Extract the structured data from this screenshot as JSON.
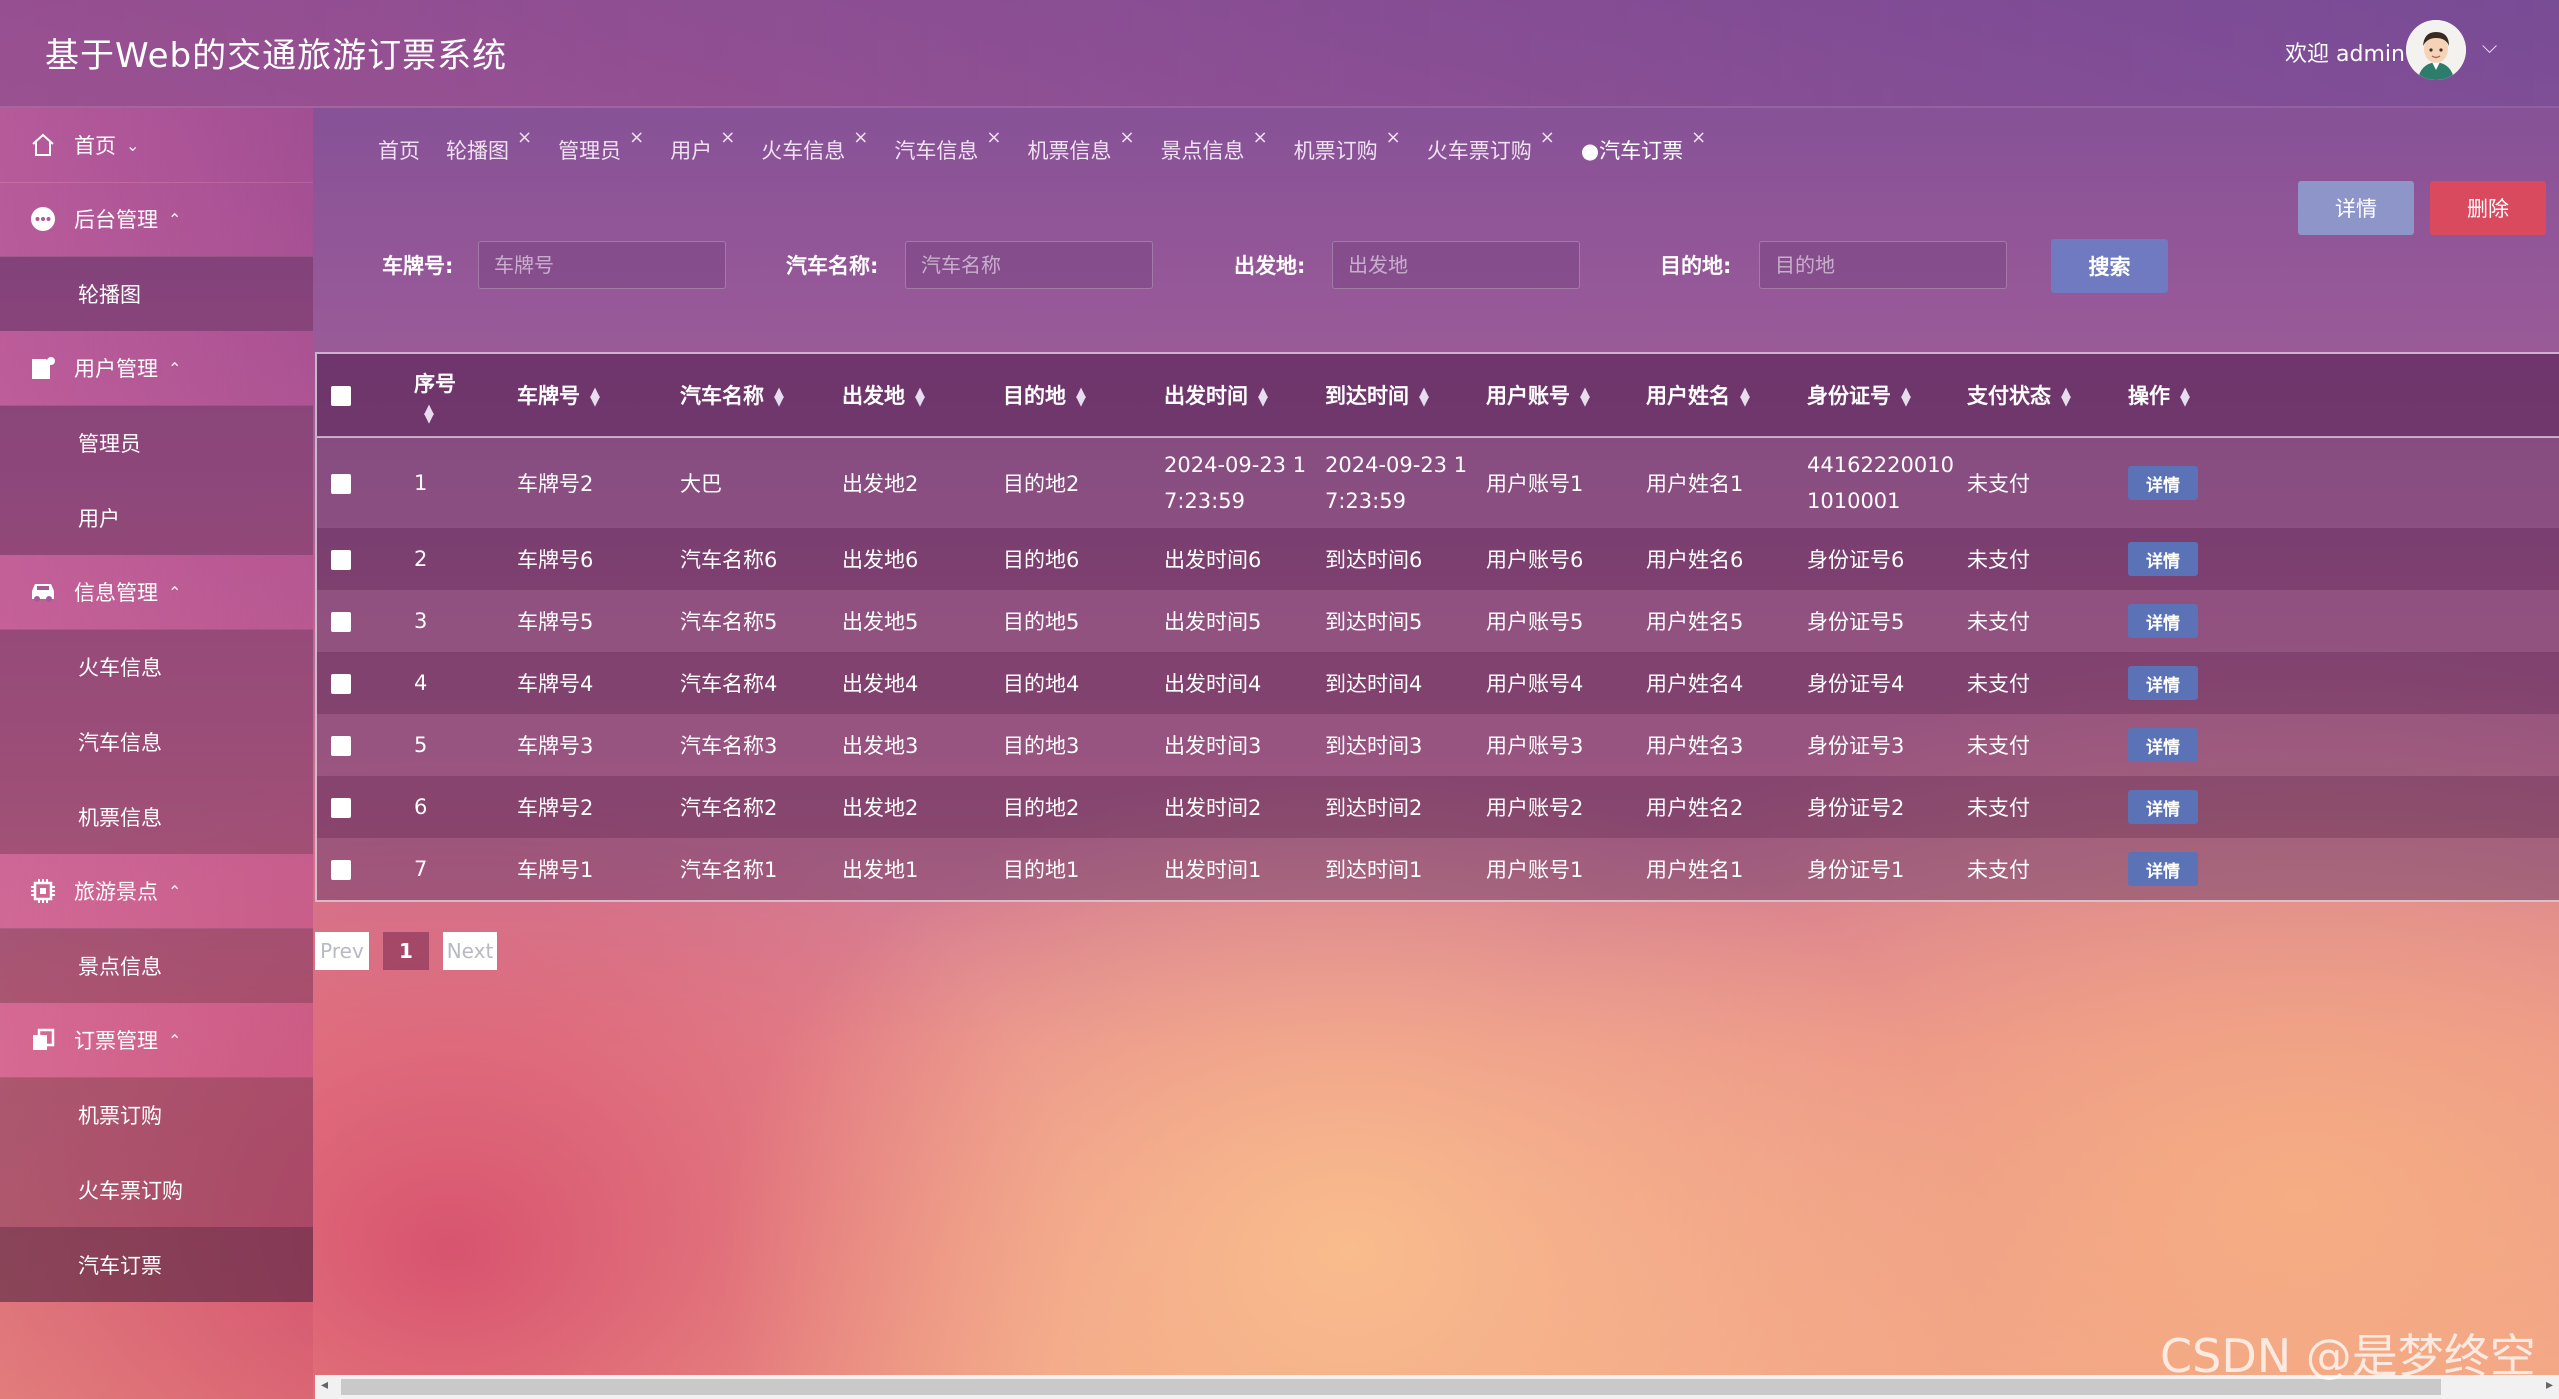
{
  "header": {
    "title": "基于Web的交通旅游订票系统",
    "welcome": "欢迎 admin",
    "avatar_icon": "user-avatar-icon",
    "dropdown_icon": "chevron-down-icon"
  },
  "sidebar": {
    "items": [
      {
        "label": "首页",
        "icon": "home-icon",
        "caret": "⌄"
      },
      {
        "label": "后台管理",
        "icon": "dots-icon",
        "caret": "⌃"
      },
      {
        "label": "轮播图"
      },
      {
        "label": "用户管理",
        "icon": "user-card-icon",
        "caret": "⌃"
      },
      {
        "label": "管理员"
      },
      {
        "label": "用户"
      },
      {
        "label": "信息管理",
        "icon": "car-icon",
        "caret": "⌃"
      },
      {
        "label": "火车信息"
      },
      {
        "label": "汽车信息"
      },
      {
        "label": "机票信息"
      },
      {
        "label": "旅游景点",
        "icon": "chip-icon",
        "caret": "⌃"
      },
      {
        "label": "景点信息"
      },
      {
        "label": "订票管理",
        "icon": "copy-icon",
        "caret": "⌃"
      },
      {
        "label": "机票订购"
      },
      {
        "label": "火车票订购"
      },
      {
        "label": "汽车订票"
      }
    ]
  },
  "tabs": [
    {
      "label": "首页",
      "closable": false
    },
    {
      "label": "轮播图",
      "closable": true
    },
    {
      "label": "管理员",
      "closable": true
    },
    {
      "label": "用户",
      "closable": true
    },
    {
      "label": "火车信息",
      "closable": true
    },
    {
      "label": "汽车信息",
      "closable": true
    },
    {
      "label": "机票信息",
      "closable": true
    },
    {
      "label": "景点信息",
      "closable": true
    },
    {
      "label": "机票订购",
      "closable": true
    },
    {
      "label": "火车票订购",
      "closable": true
    },
    {
      "label": "●汽车订票",
      "closable": true
    }
  ],
  "tab_close": "×",
  "actions": {
    "detail": "详情",
    "delete": "删除"
  },
  "search": {
    "plate_label": "车牌号:",
    "plate_placeholder": "车牌号",
    "name_label": "汽车名称:",
    "name_placeholder": "汽车名称",
    "from_label": "出发地:",
    "from_placeholder": "出发地",
    "to_label": "目的地:",
    "to_placeholder": "目的地",
    "button": "搜索"
  },
  "table": {
    "columns": [
      "序号",
      "车牌号",
      "汽车名称",
      "出发地",
      "目的地",
      "出发时间",
      "到达时间",
      "用户账号",
      "用户姓名",
      "身份证号",
      "支付状态",
      "操作"
    ],
    "row_button": "详情",
    "rows": [
      [
        "1",
        "车牌号2",
        "大巴",
        "出发地2",
        "目的地2",
        "2024-09-23 1|7:23:59",
        "2024-09-23 1|7:23:59",
        "用户账号1",
        "用户姓名1",
        "44162220010|1010001",
        "未支付"
      ],
      [
        "2",
        "车牌号6",
        "汽车名称6",
        "出发地6",
        "目的地6",
        "出发时间6",
        "到达时间6",
        "用户账号6",
        "用户姓名6",
        "身份证号6",
        "未支付"
      ],
      [
        "3",
        "车牌号5",
        "汽车名称5",
        "出发地5",
        "目的地5",
        "出发时间5",
        "到达时间5",
        "用户账号5",
        "用户姓名5",
        "身份证号5",
        "未支付"
      ],
      [
        "4",
        "车牌号4",
        "汽车名称4",
        "出发地4",
        "目的地4",
        "出发时间4",
        "到达时间4",
        "用户账号4",
        "用户姓名4",
        "身份证号4",
        "未支付"
      ],
      [
        "5",
        "车牌号3",
        "汽车名称3",
        "出发地3",
        "目的地3",
        "出发时间3",
        "到达时间3",
        "用户账号3",
        "用户姓名3",
        "身份证号3",
        "未支付"
      ],
      [
        "6",
        "车牌号2",
        "汽车名称2",
        "出发地2",
        "目的地2",
        "出发时间2",
        "到达时间2",
        "用户账号2",
        "用户姓名2",
        "身份证号2",
        "未支付"
      ],
      [
        "7",
        "车牌号1",
        "汽车名称1",
        "出发地1",
        "目的地1",
        "出发时间1",
        "到达时间1",
        "用户账号1",
        "用户姓名1",
        "身份证号1",
        "未支付"
      ]
    ]
  },
  "pagination": {
    "prev": "Prev",
    "current": "1",
    "next": "Next"
  },
  "watermark": "CSDN @是梦终空"
}
